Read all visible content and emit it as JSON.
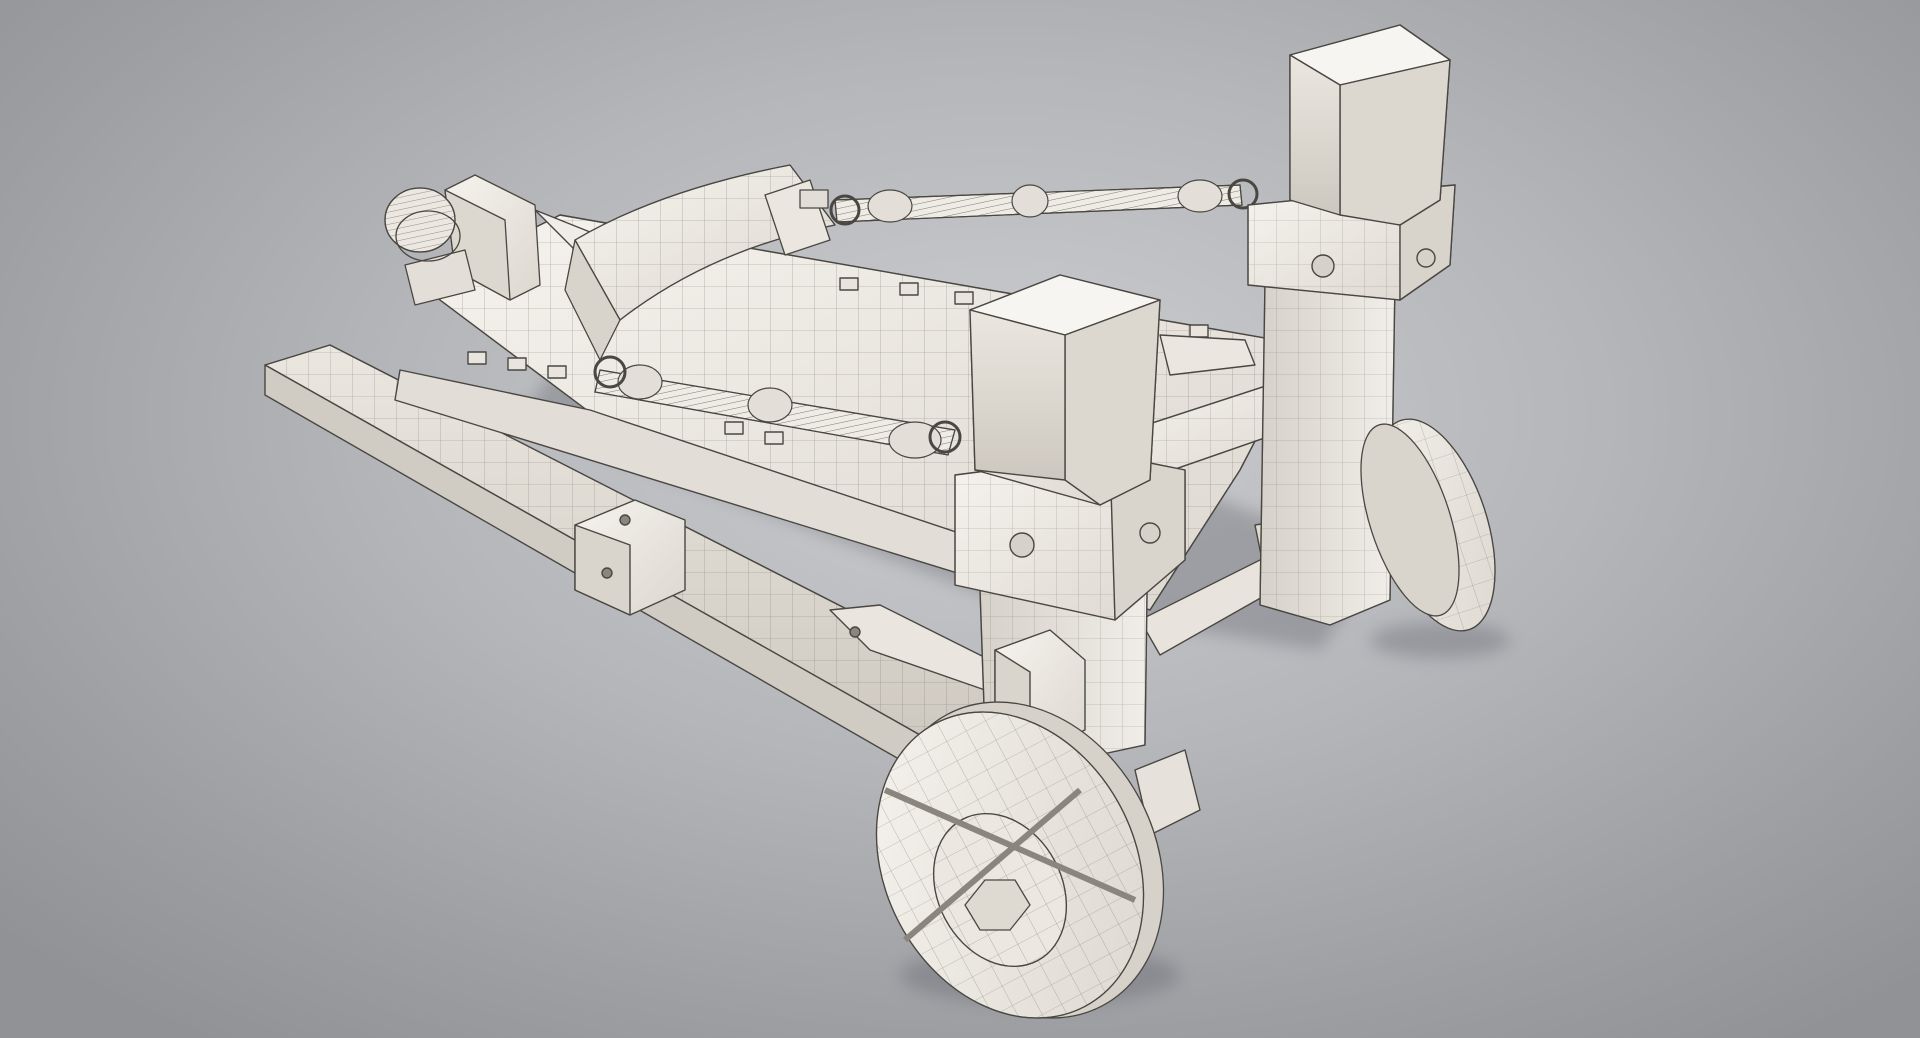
{
  "scene": {
    "subject": "catapult-wireframe-model",
    "colors": {
      "background_center": "#cbcdd0",
      "background_edge": "#909296",
      "model_fill_light": "#f2efea",
      "model_fill_mid": "#e3dfd8",
      "model_fill_dark": "#cfcac2",
      "wire_color": "#4a4742",
      "shadow": "#6f7278"
    },
    "parts": [
      "base-frame",
      "throwing-arm-bucket",
      "torsion-rope-upper",
      "torsion-rope-lower",
      "front-post-left",
      "front-post-right",
      "rear-winch",
      "wheel-front",
      "wheel-rear"
    ]
  }
}
